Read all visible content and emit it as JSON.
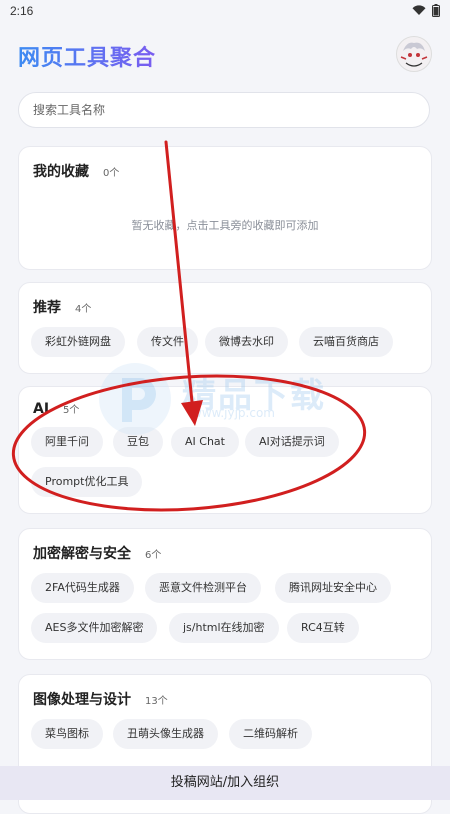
{
  "status": {
    "time": "2:16"
  },
  "app": {
    "title": "网页工具聚合"
  },
  "search": {
    "placeholder": "搜索工具名称"
  },
  "favorites": {
    "title": "我的收藏",
    "count": "0个",
    "empty": "暂无收藏，点击工具旁的收藏即可添加"
  },
  "recommend": {
    "title": "推荐",
    "count": "4个",
    "items": [
      "彩虹外链网盘",
      "传文件",
      "微博去水印",
      "云喵百货商店"
    ]
  },
  "ai": {
    "title": "AI",
    "count": "5个",
    "items": [
      "阿里千问",
      "豆包",
      "AI Chat",
      "AI对话提示词",
      "Prompt优化工具"
    ]
  },
  "security": {
    "title": "加密解密与安全",
    "count": "6个",
    "items": [
      "2FA代码生成器",
      "恶意文件检测平台",
      "腾讯网址安全中心",
      "AES多文件加密解密",
      "js/html在线加密",
      "RC4互转"
    ]
  },
  "image": {
    "title": "图像处理与设计",
    "count": "13个",
    "items": [
      "菜鸟图标",
      "丑萌头像生成器",
      "二维码解析"
    ]
  },
  "watermark": {
    "text": "精品下载",
    "url": "www.jyjp.com"
  },
  "bottom": {
    "label": "投稿网站/加入组织"
  },
  "colors": {
    "title_gradient_start": "#3d8bf2",
    "title_gradient_end": "#7a5cf0",
    "annotation": "#d11f1f"
  }
}
